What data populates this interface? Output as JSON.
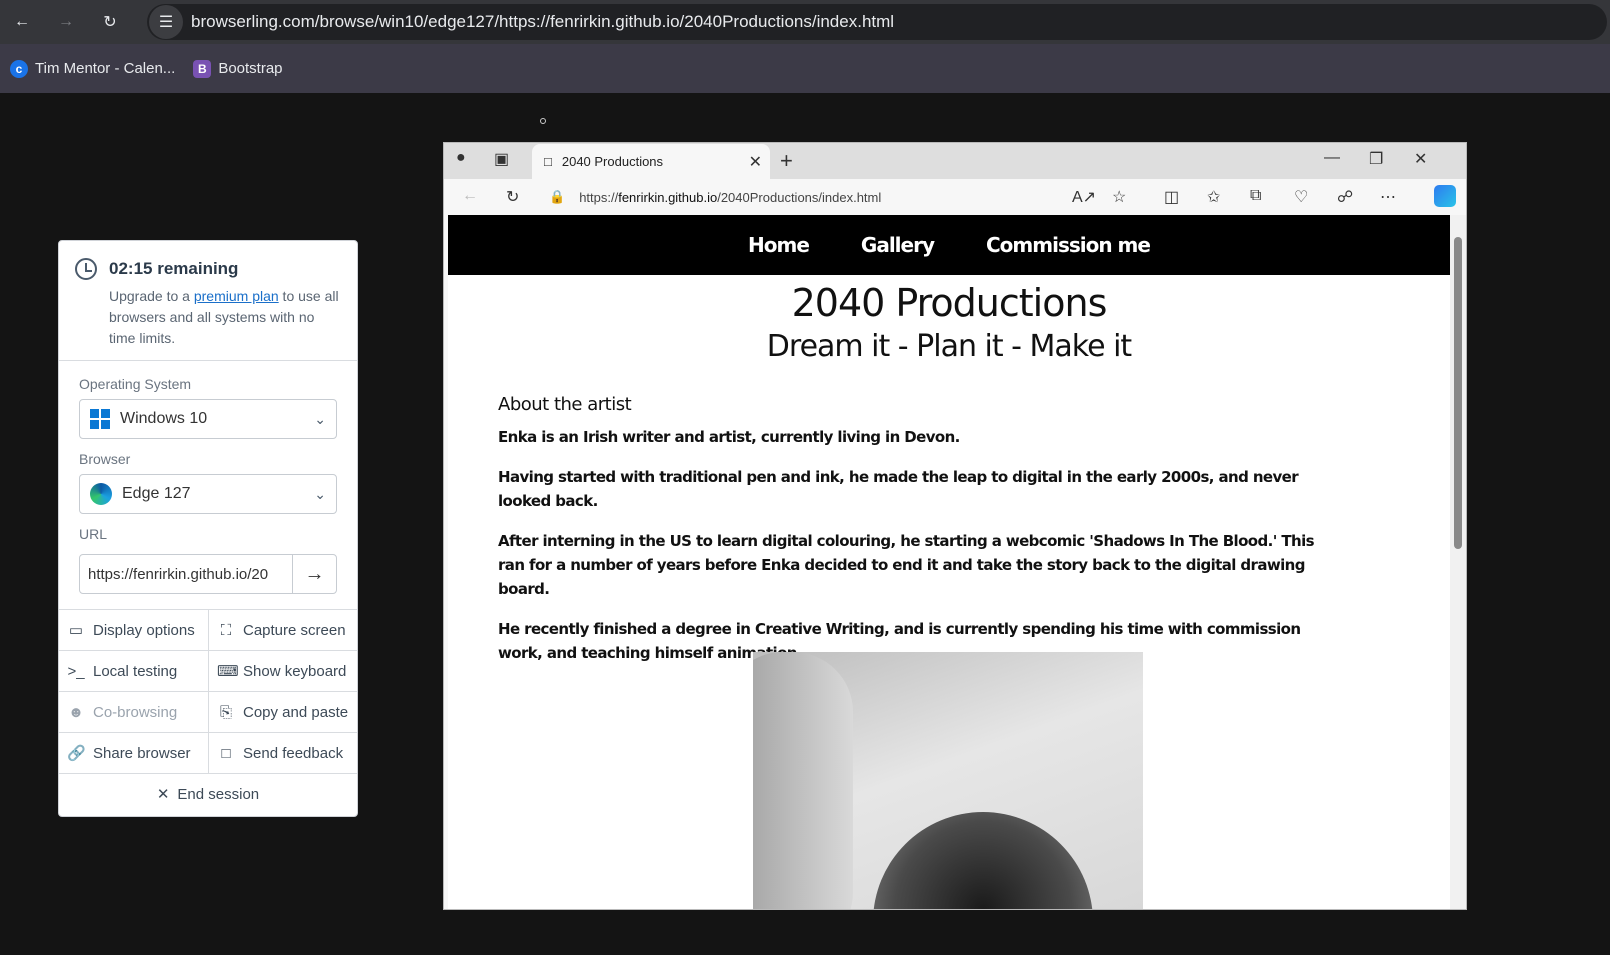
{
  "chrome": {
    "address": "browserling.com/browse/win10/edge127/https://fenrirkin.github.io/2040Productions/index.html",
    "bookmarks": [
      {
        "label": "Tim Mentor - Calen...",
        "icon": "c"
      },
      {
        "label": "Bootstrap",
        "icon": "B"
      }
    ]
  },
  "panel": {
    "timer": "02:15 remaining",
    "upgrade_pre": "Upgrade to a ",
    "upgrade_link": "premium plan",
    "upgrade_post": " to use all browsers and all systems with no time limits.",
    "os_label": "Operating System",
    "os_value": "Windows 10",
    "browser_label": "Browser",
    "browser_value": "Edge 127",
    "url_label": "URL",
    "url_value": "https://fenrirkin.github.io/20",
    "actions": {
      "display_options": "Display options",
      "capture_screen": "Capture screen",
      "local_testing": "Local testing",
      "show_keyboard": "Show keyboard",
      "co_browsing": "Co-browsing",
      "copy_and_paste": "Copy and paste",
      "share_browser": "Share browser",
      "send_feedback": "Send feedback"
    },
    "end_session": "End session"
  },
  "edge": {
    "tab_title": "2040 Productions",
    "url_prefix": "https://",
    "url_host": "fenrirkin.github.io",
    "url_path": "/2040Productions/index.html"
  },
  "site": {
    "nav": [
      "Home",
      "Gallery",
      "Commission me"
    ],
    "title": "2040 Productions",
    "subtitle": "Dream it - Plan it - Make it",
    "about_heading": "About the artist",
    "paragraphs": [
      "Enka is an Irish writer and artist, currently living in Devon.",
      "Having started with traditional pen and ink, he made the leap to digital in the early 2000s, and never looked back.",
      "After interning in the US to learn digital colouring, he starting a webcomic 'Shadows In The Blood.' This ran for a number of years before Enka decided to end it and take the story back to the digital drawing board.",
      "He recently finished a degree in Creative Writing, and is currently spending his time with commission work, and teaching himself animation."
    ]
  }
}
